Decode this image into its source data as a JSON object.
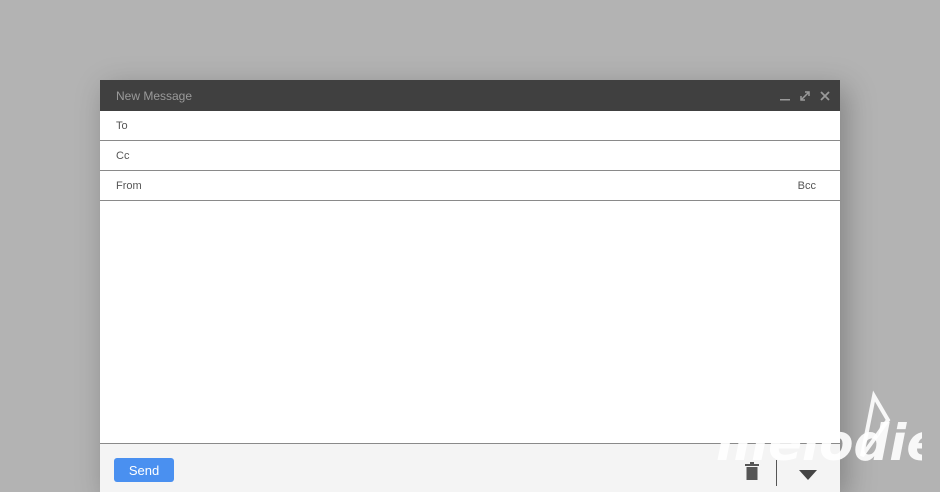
{
  "compose": {
    "title": "New Message",
    "window_controls": {
      "minimize_icon": "minimize-icon",
      "expand_icon": "expand-icon",
      "close_icon": "close-icon"
    },
    "fields": {
      "to_label": "To",
      "to_value": "",
      "cc_label": "Cc",
      "cc_value": "",
      "from_label": "From",
      "from_value": "",
      "bcc_label": "Bcc"
    },
    "body_value": "",
    "footer": {
      "send_label": "Send",
      "trash_icon": "trash-icon",
      "more_icon": "triangle-down-icon"
    }
  },
  "watermark": {
    "text": "melodie"
  },
  "colors": {
    "background": "#b3b3b3",
    "titlebar": "#404040",
    "send_button": "#4a90f0",
    "footer": "#f4f4f4"
  }
}
